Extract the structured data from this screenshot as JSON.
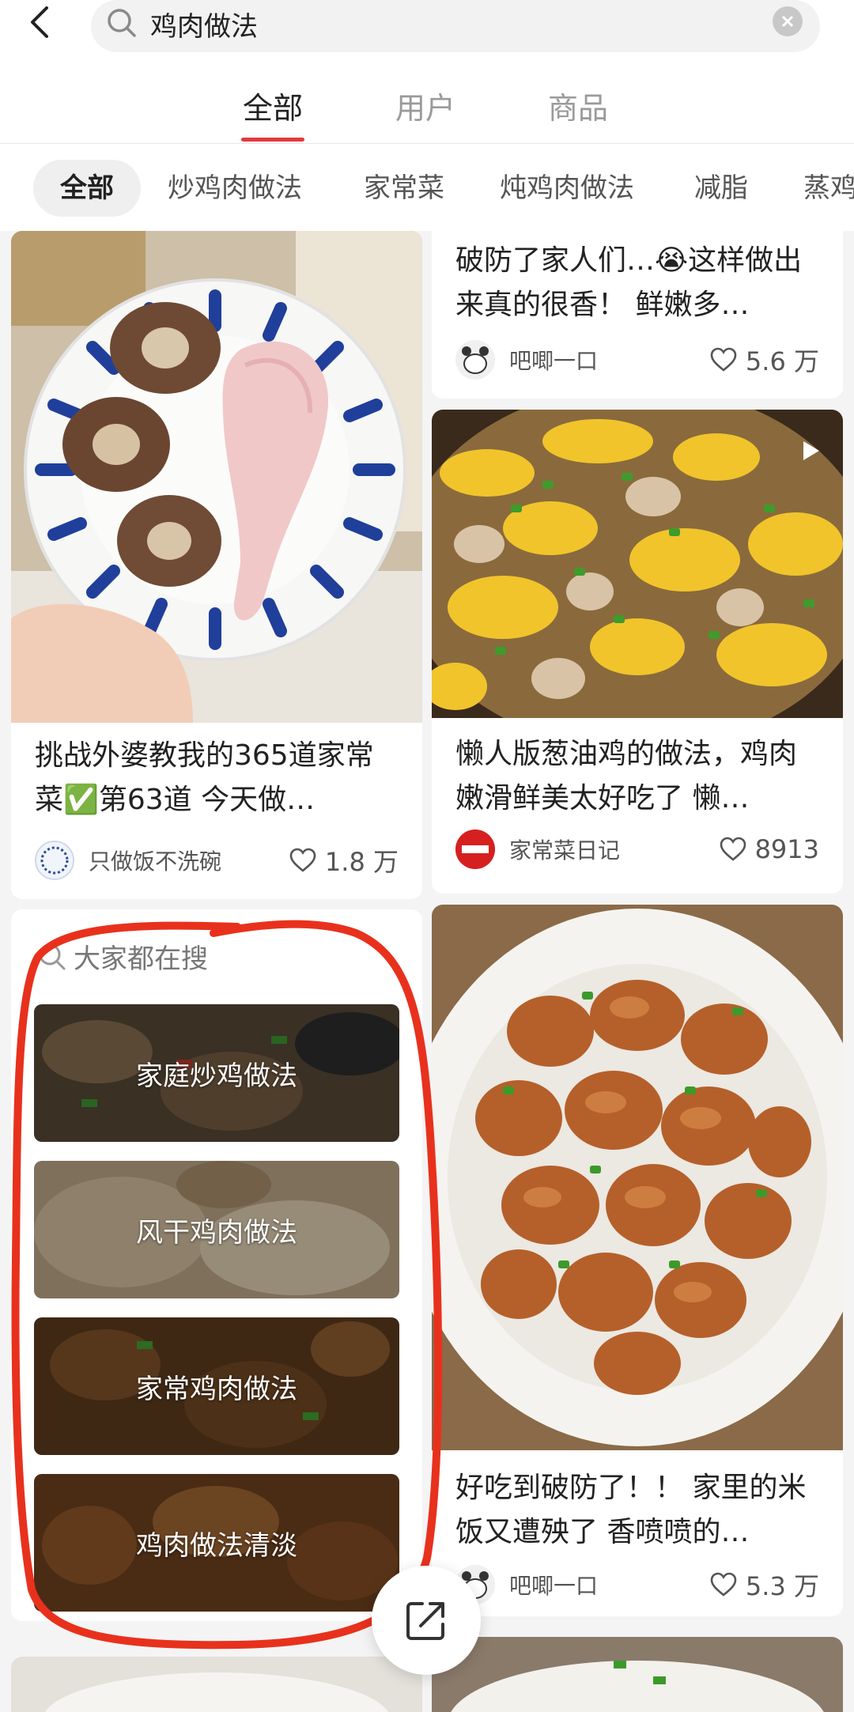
{
  "search": {
    "query": "鸡肉做法"
  },
  "tabs": [
    {
      "label": "全部",
      "active": true
    },
    {
      "label": "用户",
      "active": false
    },
    {
      "label": "商品",
      "active": false
    }
  ],
  "chips": [
    "全部",
    "炒鸡肉做法",
    "家常菜",
    "炖鸡肉做法",
    "减脂",
    "蒸鸡"
  ],
  "cards": {
    "left_1": {
      "title": "挑战外婆教我的365道家常菜✅第63道 今天做…",
      "author": "只做饭不洗碗",
      "likes": "1.8 万"
    },
    "right_1": {
      "title": "破防了家人们…😭这样做出来真的很香！ 鲜嫩多…",
      "author": "吧唧一口",
      "likes": "5.6 万"
    },
    "right_2": {
      "title": "懒人版葱油鸡的做法，鸡肉嫩滑鲜美太好吃了 懒…",
      "author": "家常菜日记",
      "likes": "8913"
    },
    "right_3": {
      "title": "好吃到破防了！！ 家里的米饭又遭殃了 香喷喷的…",
      "author": "吧唧一口",
      "likes": "5.3 万"
    }
  },
  "hot_searches": {
    "header": "大家都在搜",
    "items": [
      "家庭炒鸡做法",
      "风干鸡肉做法",
      "家常鸡肉做法",
      "鸡肉做法清淡"
    ]
  },
  "colors": {
    "accent": "#e4393c",
    "annotation": "#e8311d"
  }
}
